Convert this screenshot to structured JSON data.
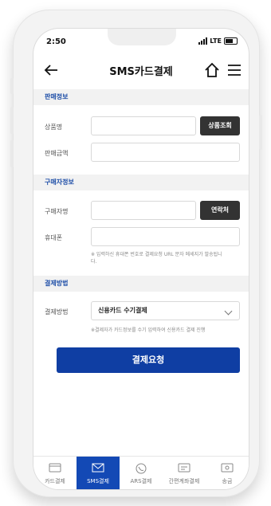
{
  "status_bar": {
    "time": "2:50",
    "network": "LTE"
  },
  "header": {
    "title": "SMS카드결제"
  },
  "sections": {
    "sales": "판매정보",
    "buyer": "구매자정보",
    "payment": "결제방법"
  },
  "form": {
    "product_name_label": "상품명",
    "product_lookup_button": "상품조회",
    "sale_amount_label": "판매금액",
    "buyer_name_label": "구매자명",
    "contacts_button": "연락처",
    "phone_label": "휴대폰",
    "phone_note": "※ 입력하신 휴대폰 번호로 결제요청 URL 문자 메세지가 발송됩니다.",
    "payment_method_label": "결제방법",
    "payment_method_value": "신용카드 수기결제",
    "payment_note": "※결제자가 카드정보를 수기 입력하여 신용카드 결제 진행"
  },
  "actions": {
    "pay_request": "결제요청"
  },
  "bottom_nav": [
    {
      "label": "카드결제",
      "icon": "card-icon",
      "active": false
    },
    {
      "label": "SMS결제",
      "icon": "envelope-icon",
      "active": true
    },
    {
      "label": "ARS결제",
      "icon": "phone-icon",
      "active": false
    },
    {
      "label": "간편계좌결제",
      "icon": "account-icon",
      "active": false
    },
    {
      "label": "송금",
      "icon": "transfer-icon",
      "active": false
    }
  ],
  "colors": {
    "accent": "#1349b5",
    "button_primary": "#0f3ea3",
    "section_text": "#1f4fa8",
    "dark_button": "#333333"
  }
}
